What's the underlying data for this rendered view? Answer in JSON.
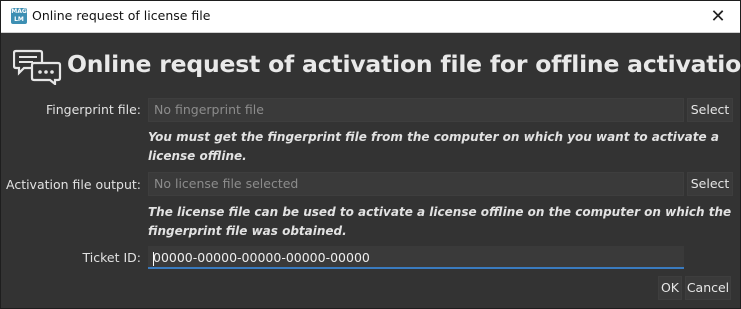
{
  "window": {
    "title": "Online request of license file",
    "app_icon_text": "MAG\nLM",
    "close_glyph": "✕"
  },
  "header": {
    "title": "Online request of activation file for offline activation"
  },
  "fingerprint": {
    "label": "Fingerprint file:",
    "placeholder": "No fingerprint file",
    "select_label": "Select",
    "note_line1": "You must get the fingerprint file from the computer on which you want to activate a",
    "note_line2": "license offline."
  },
  "activation": {
    "label": "Activation file output:",
    "placeholder": "No license file selected",
    "select_label": "Select",
    "note_line1": "The license file can be used to activate a license offline on the computer on which the",
    "note_line2": "fingerprint file was obtained."
  },
  "ticket": {
    "label": "Ticket ID:",
    "value": "00000-00000-00000-00000-00000"
  },
  "buttons": {
    "ok_label": "OK",
    "cancel_label": "Cancel"
  },
  "colors": {
    "background": "#333333",
    "field": "#3a3a3a",
    "focus_accent": "#3a7bbf"
  }
}
